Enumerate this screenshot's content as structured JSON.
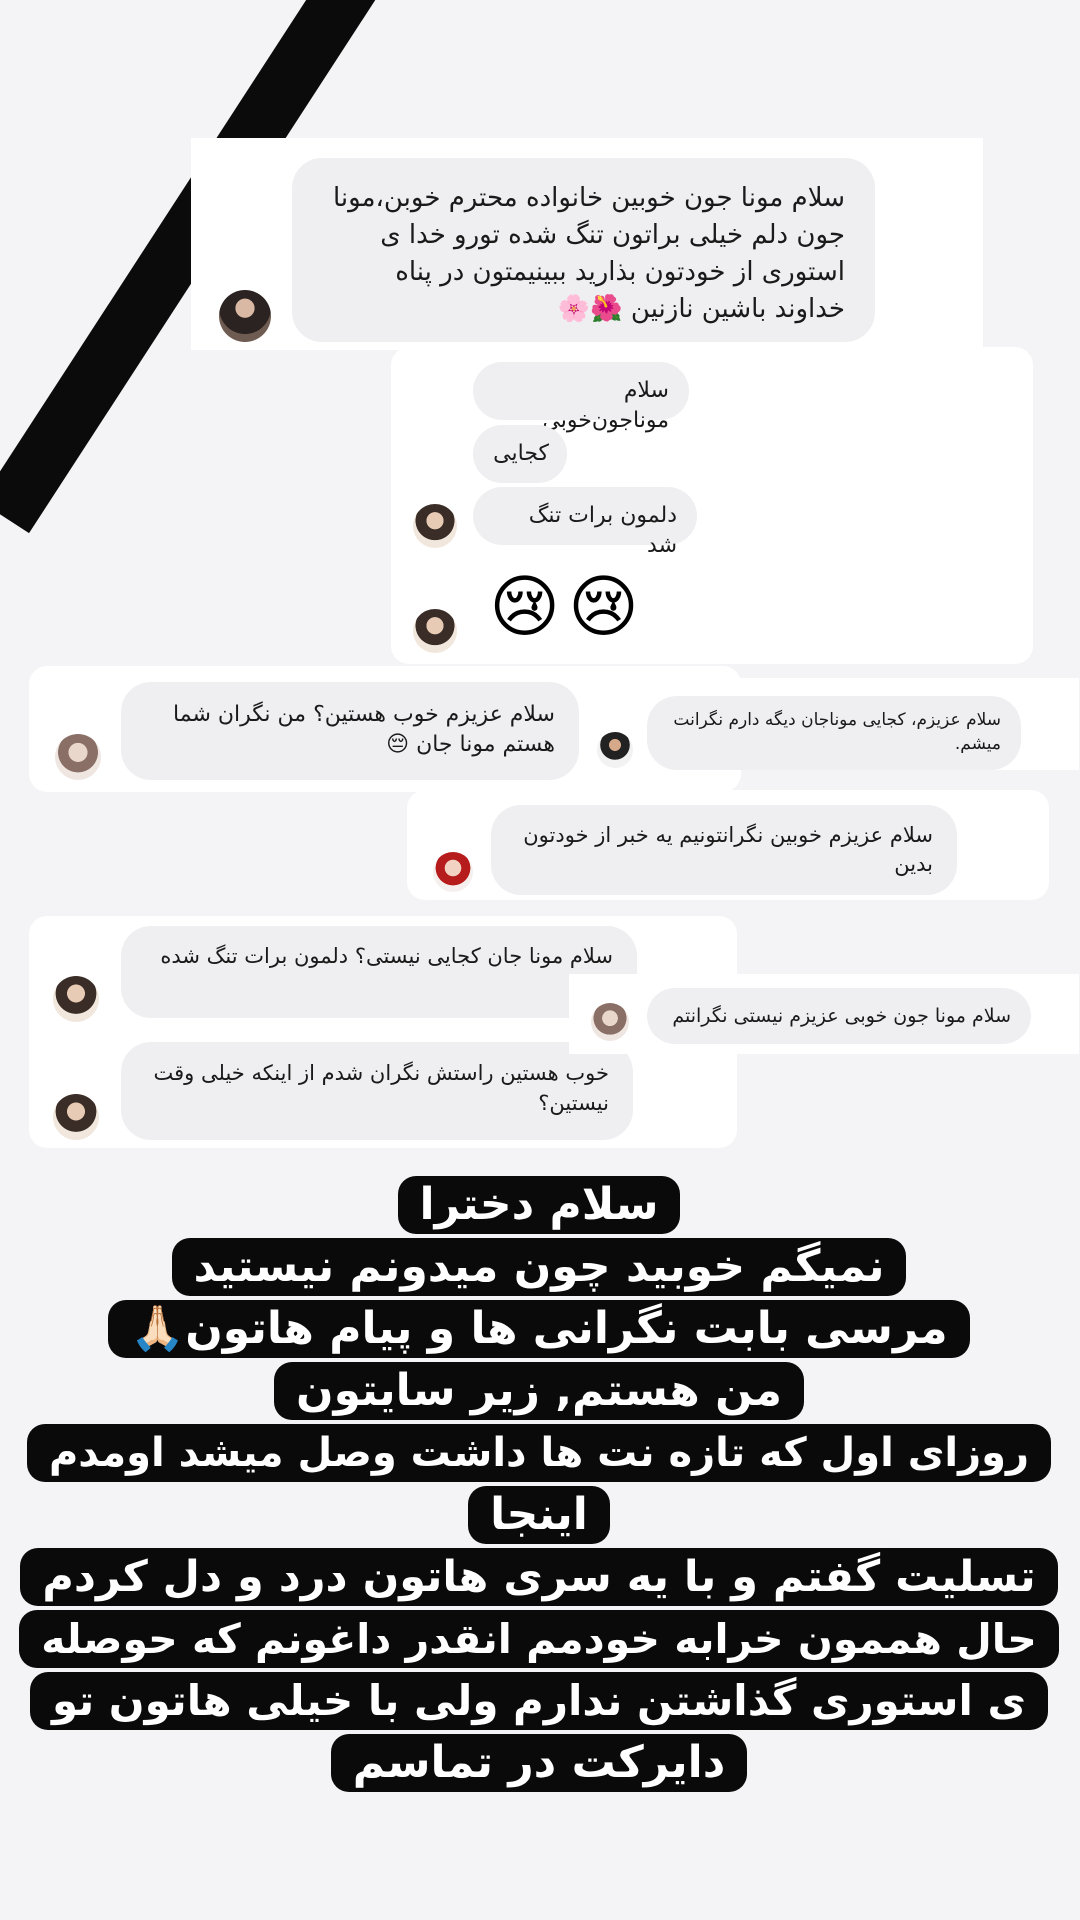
{
  "messages": {
    "top": {
      "text": "سلام مونا جون خوبین خانواده محترم خوبن،مونا جون دلم خیلی براتون تنگ شده تورو خدا ی استوری از خودتون بذارید ببینیمتون در پناه خداوند باشین نازنین",
      "emojis": "🌺🌸"
    },
    "group": {
      "b1": "سلام موناجون‌خوبی",
      "b2": "کجایی",
      "b3": "دلمون برات تنگ شد",
      "emojis": "😢😢"
    },
    "left1": {
      "text": "سلام عزیزم خوب هستین؟ من نگران شما هستم مونا جان",
      "emoji": "😔"
    },
    "right1": {
      "text": "سلام عزیزم، کجایی موناجان دیگه دارم نگرانت میشم."
    },
    "mid": {
      "text": "سلام عزیزم خوبین نگرانتونیم یه خبر از خودتون بدین"
    },
    "left2": {
      "text": "سلام مونا جان کجایی نیستی؟ دلمون برات تنگ شده"
    },
    "right2": {
      "text": "سلام مونا جون خوبی عزیزم نیستی نگرانتم"
    },
    "left3": {
      "text": "خوب هستین راستش نگران شدم از اینکه خیلی وقت نیستین؟"
    }
  },
  "story_text": {
    "l1": "سلام دخترا",
    "l2": "نمیگم خوبید  چون میدونم نیستید",
    "l3": "مرسی بابت نگرانی ها و پیام هاتون🙏🏻",
    "l4": "من هستم,  زیر سایتون",
    "l5": "روزای اول که تازه نت ها داشت وصل میشد اومدم",
    "l6": "اینجا",
    "l7": "تسلیت گفتم و با یه سری هاتون درد و دل کردم",
    "l8": "حال هممون خرابه خودمم انقدر داغونم که حوصله",
    "l9": "ی استوری گذاشتن ندارم ولی با خیلی هاتون تو",
    "l10": "دایرکت در تماسم"
  },
  "colors": {
    "background": "#f4f4f6",
    "bubble": "#efeff1",
    "stripe": "#0b0b0b",
    "story_box": "#0a0a0a"
  }
}
